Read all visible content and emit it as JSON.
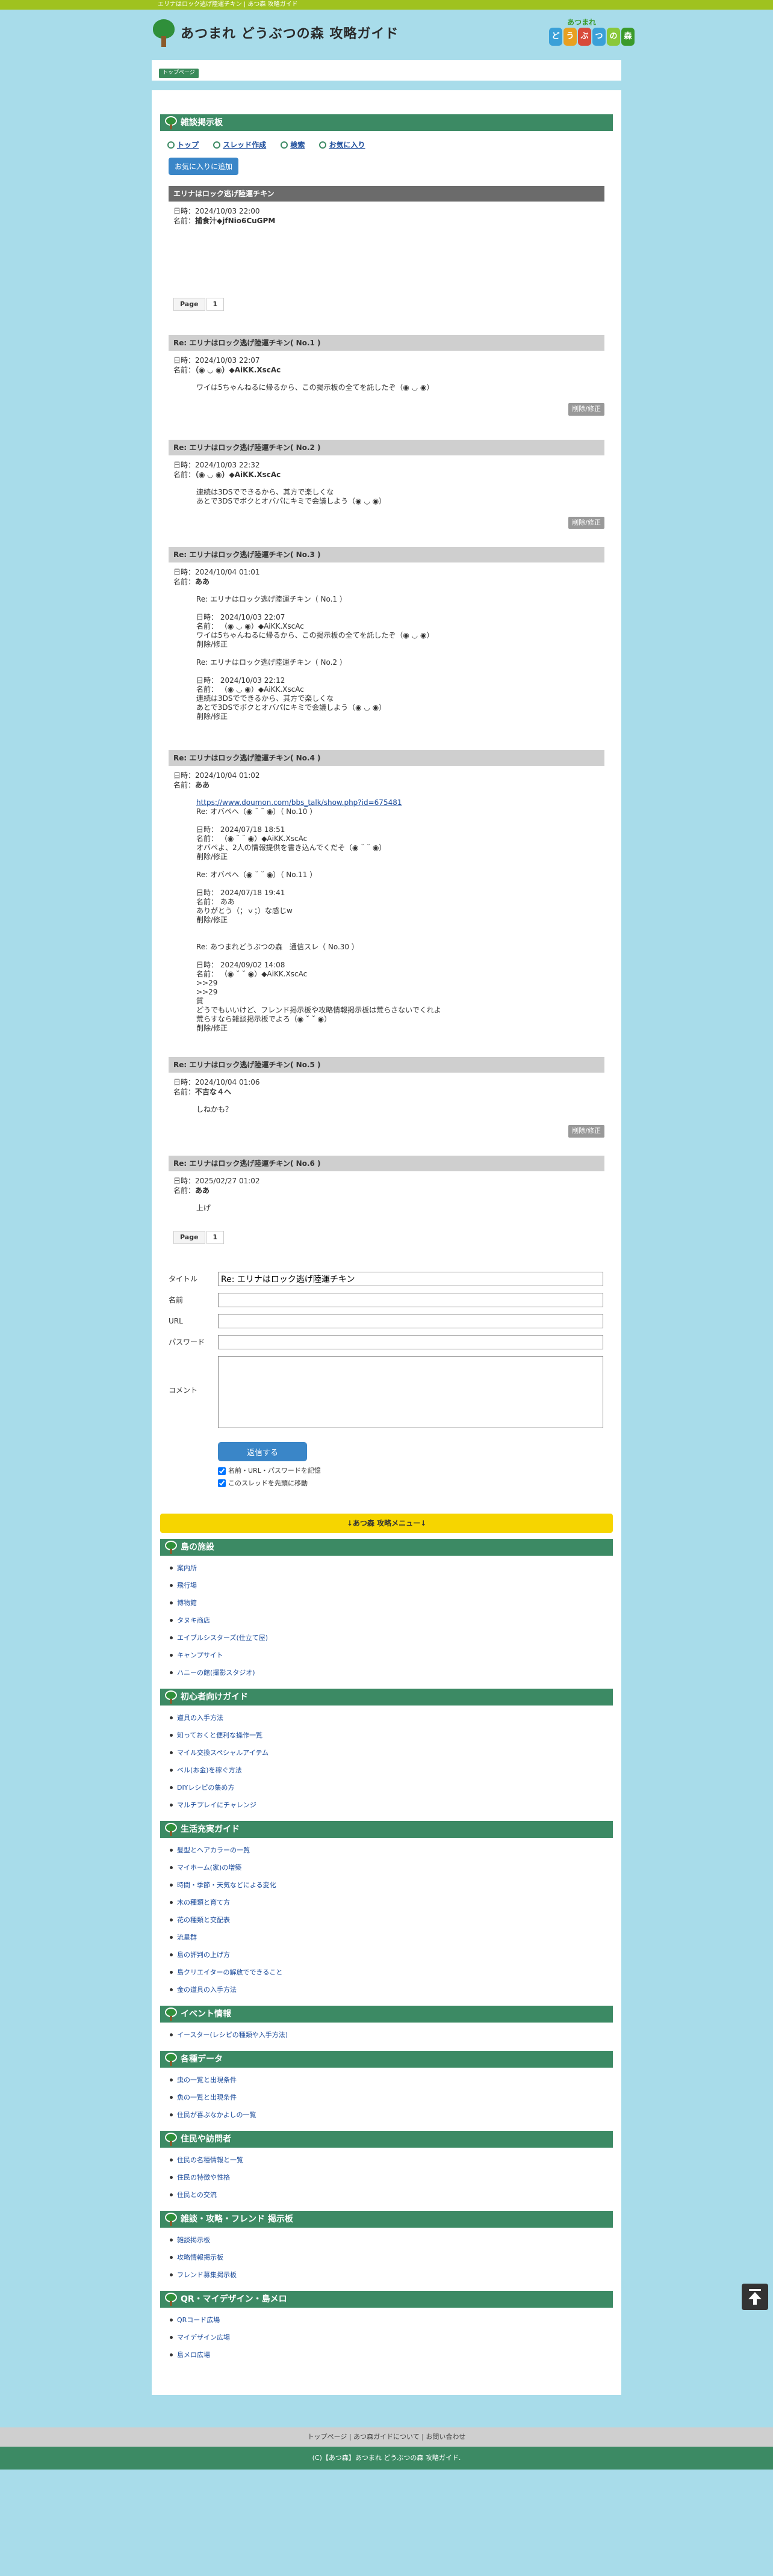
{
  "top_strip": "エリナはロック逃げ陸運チキン | あつ森 攻略ガイド",
  "header": {
    "site_title": "あつまれ どうぶつの森 攻略ガイド",
    "logo_sub": "あつまれ",
    "logo_chars": [
      "ど",
      "う",
      "ぶ",
      "つ",
      "の",
      "森"
    ],
    "logo_colors": [
      "#3aa0d8",
      "#e8a020",
      "#d84a3a",
      "#3aa0d8",
      "#8ac83a",
      "#3a9a2a"
    ]
  },
  "breadcrumb": "トップページ",
  "board": {
    "title": "雑談掲示板",
    "nav": [
      "トップ",
      "スレッド作成",
      "検索",
      "お気に入り"
    ],
    "fav_button": "お気に入りに追加"
  },
  "thread": {
    "title": "エリナはロック逃げ陸運チキン",
    "date": "日時：2024/10/03 22:00",
    "name_label": "名前：",
    "name": "捕食汁◆jfNio6CuGPM"
  },
  "pager": {
    "label": "Page",
    "current": "1"
  },
  "posts": [
    {
      "head": "Re: エリナはロック逃げ陸運チキン( No.1 )",
      "date": "日時：2024/10/03 22:07",
      "name_label": "名前：",
      "name": "（◉ ◡ ◉）◆AiKK.XscAc",
      "body": "ワイは5ちゃんねるに帰るから、この掲示板の全てを託したぞ（◉ ◡ ◉）",
      "del": "削除/修正"
    },
    {
      "head": "Re: エリナはロック逃げ陸運チキン( No.2 )",
      "date": "日時：2024/10/03 22:32",
      "name_label": "名前：",
      "name": "（◉ ◡ ◉）◆AiKK.XscAc",
      "body": "連続は3DSでできるから、其方で楽しくな\nあとで3DSでボクとオバパにキミで会議しよう（◉ ◡ ◉）",
      "del": "削除/修正"
    },
    {
      "head": "Re: エリナはロック逃げ陸運チキン( No.3 )",
      "date": "日時：2024/10/04 01:01",
      "name_label": "名前：",
      "name": "ああ",
      "body": "Re: エリナはロック逃げ陸運チキン（ No.1 ）\n\n日時： 2024/10/03 22:07\n名前： （◉ ◡ ◉）◆AiKK.XscAc\nワイは5ちゃんねるに帰るから、この掲示板の全てを託したぞ（◉ ◡ ◉）\n削除/修正\n\nRe: エリナはロック逃げ陸運チキン（ No.2 ）\n\n日時： 2024/10/03 22:12\n名前： （◉ ◡ ◉）◆AiKK.XscAc\n連続は3DSでできるから、其方で楽しくな\nあとで3DSでボクとオバパにキミで会議しよう（◉ ◡ ◉）\n削除/修正",
      "del": ""
    },
    {
      "head": "Re: エリナはロック逃げ陸運チキン( No.4 )",
      "date": "日時：2024/10/04 01:02",
      "name_label": "名前：",
      "name": "ああ",
      "link": "https://www.doumon.com/bbs_talk/show.php?id=675481",
      "body": "Re: オバペへ（◉ ˘ ˘ ◉）（ No.10 ）\n\n日時： 2024/07/18 18:51\n名前： （◉ ˘ ˘ ◉）◆AiKK.XscAc\nオバペよ、2人の情報提供を書き込んでくだそ（◉ ˘ ˘ ◉）\n削除/修正\n\nRe: オバペへ（◉ ˘ ˘ ◉）（ No.11 ）\n\n日時： 2024/07/18 19:41\n名前： ああ\nありがとう（；ｖ；）な感じw\n削除/修正\n\n\nRe: あつまれどうぶつの森　通信スレ（ No.30 ）\n\n日時： 2024/09/02 14:08\n名前： （◉ ˘ ˘ ◉）◆AiKK.XscAc\n>>29\n>>29\n質\nどうでもいいけど、フレンド掲示板や攻略情報掲示板は荒らさないでくれよ\n荒らすなら雑談掲示板でよろ（◉ ˘ ˘ ◉）\n削除/修正",
      "del": ""
    },
    {
      "head": "Re: エリナはロック逃げ陸運チキン( No.5 )",
      "date": "日時：2024/10/04 01:06",
      "name_label": "名前：",
      "name": "不吉な４ヘ",
      "body": "しねかも？",
      "del": "削除/修正"
    },
    {
      "head": "Re: エリナはロック逃げ陸運チキン( No.6 )",
      "date": "日時：2025/02/27 01:02",
      "name_label": "名前：",
      "name": "ああ",
      "body": "上げ",
      "del": ""
    }
  ],
  "form": {
    "title_label": "タイトル",
    "title_value": "Re: エリナはロック逃げ陸運チキン",
    "name_label": "名前",
    "url_label": "URL",
    "password_label": "パスワード",
    "comment_label": "コメント",
    "submit": "返信する",
    "check1": "名前・URL・パスワードを記憶",
    "check2": "このスレッドを先頭に移動"
  },
  "menu_banner": "↓あつ森 攻略メニュー↓",
  "menus": [
    {
      "title": "島の施設",
      "items": [
        "案内所",
        "飛行場",
        "博物館",
        "タヌキ商店",
        "エイブルシスターズ(仕立て屋)",
        "キャンプサイト",
        "ハニーの館(撮影スタジオ)"
      ]
    },
    {
      "title": "初心者向けガイド",
      "items": [
        "道具の入手方法",
        "知っておくと便利な操作一覧",
        "マイル交換スペシャルアイテム",
        "ベル(お金)を稼ぐ方法",
        "DIYレシピの集め方",
        "マルチプレイにチャレンジ"
      ]
    },
    {
      "title": "生活充実ガイド",
      "items": [
        "髪型とヘアカラーの一覧",
        "マイホーム(家)の増築",
        "時間・季節・天気などによる変化",
        "木の種類と育て方",
        "花の種類と交配表",
        "流星群",
        "島の評判の上げ方",
        "島クリエイターの解放でできること",
        "金の道具の入手方法"
      ]
    },
    {
      "title": "イベント情報",
      "items": [
        "イースター(レシピの種類や入手方法)"
      ]
    },
    {
      "title": "各種データ",
      "items": [
        "虫の一覧と出現条件",
        "魚の一覧と出現条件",
        "住民が喜ぶなかよしの一覧"
      ]
    },
    {
      "title": "住民や訪問者",
      "items": [
        "住民の名種情報と一覧",
        "住民の特徴や性格",
        "住民との交流"
      ]
    },
    {
      "title": "雑談・攻略・フレンド 掲示板",
      "items": [
        "雑談掲示板",
        "攻略情報掲示板",
        "フレンド募集掲示板"
      ]
    },
    {
      "title": "QR・マイデザイン・島メロ",
      "items": [
        "QRコード広場",
        "マイデザイン広場",
        "島メロ広場"
      ]
    }
  ],
  "footer": {
    "links": "トップページ | あつ森ガイドについて | お問い合わせ",
    "copy": "(C)【あつ森】あつまれ どうぶつの森 攻略ガイド."
  }
}
